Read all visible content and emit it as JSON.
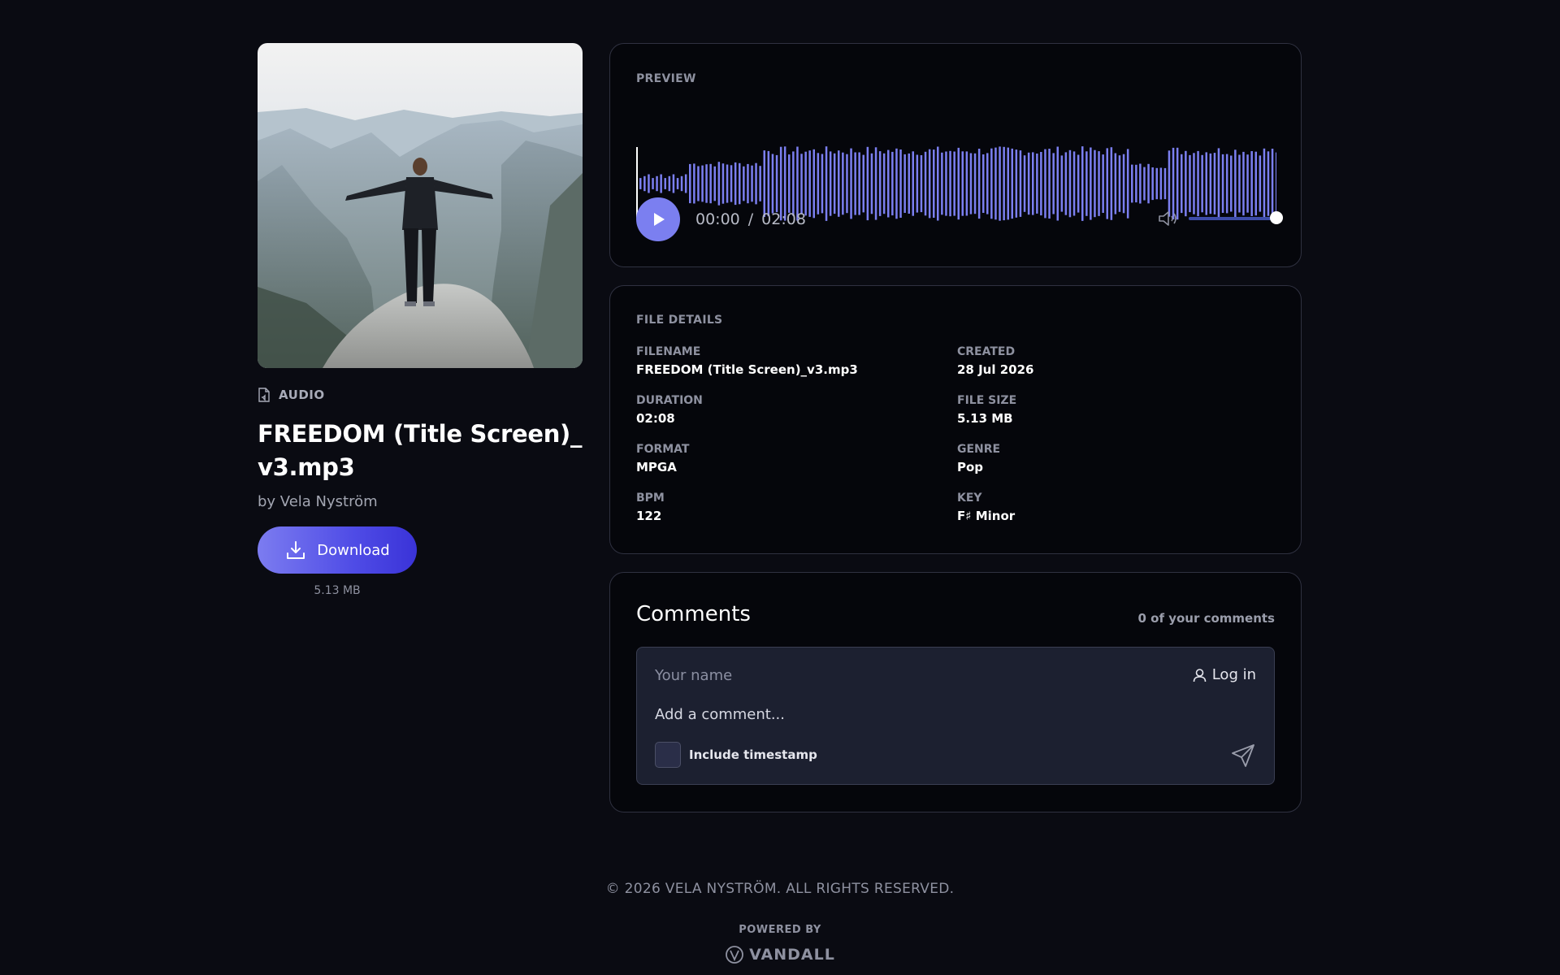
{
  "asset": {
    "type_label": "AUDIO",
    "title": "FREEDOM (Title Screen)_v3.mp3",
    "artist": "by Vela Nyström",
    "download_label": "Download",
    "download_size": "5.13 MB",
    "cover_icon": "mountain-person-photo"
  },
  "preview": {
    "label": "PREVIEW",
    "current_time": "00:00",
    "separator": "/",
    "total_time": "02:08",
    "play_icon": "play-icon",
    "volume_icon": "volume-icon",
    "volume_level": 1.0,
    "progress": 0.0,
    "wave_color": "#7b7ff0",
    "accent_color": "#7b7ff0"
  },
  "details": {
    "label": "FILE DETAILS",
    "filename_label": "FILENAME",
    "filename": "FREEDOM (Title Screen)_v3.mp3",
    "created_label": "CREATED",
    "created": "28 Jul 2026",
    "duration_label": "DURATION",
    "duration": "02:08",
    "filesize_label": "FILE SIZE",
    "filesize": "5.13 MB",
    "format_label": "FORMAT",
    "format": "MPGA",
    "genre_label": "GENRE",
    "genre": "Pop",
    "bpm_label": "BPM",
    "bpm": "122",
    "key_label": "KEY",
    "key": "F♯ Minor"
  },
  "comments": {
    "title": "Comments",
    "count": "0 of your comments",
    "name_placeholder": "Your name",
    "login_label": "Log in",
    "comment_placeholder": "Add a comment...",
    "timestamp_label": "Include timestamp"
  },
  "footer": {
    "copyright": "© 2026 VELA NYSTRÖM. ALL RIGHTS RESERVED.",
    "powered_by": "POWERED BY",
    "brand": "VANDALL"
  }
}
